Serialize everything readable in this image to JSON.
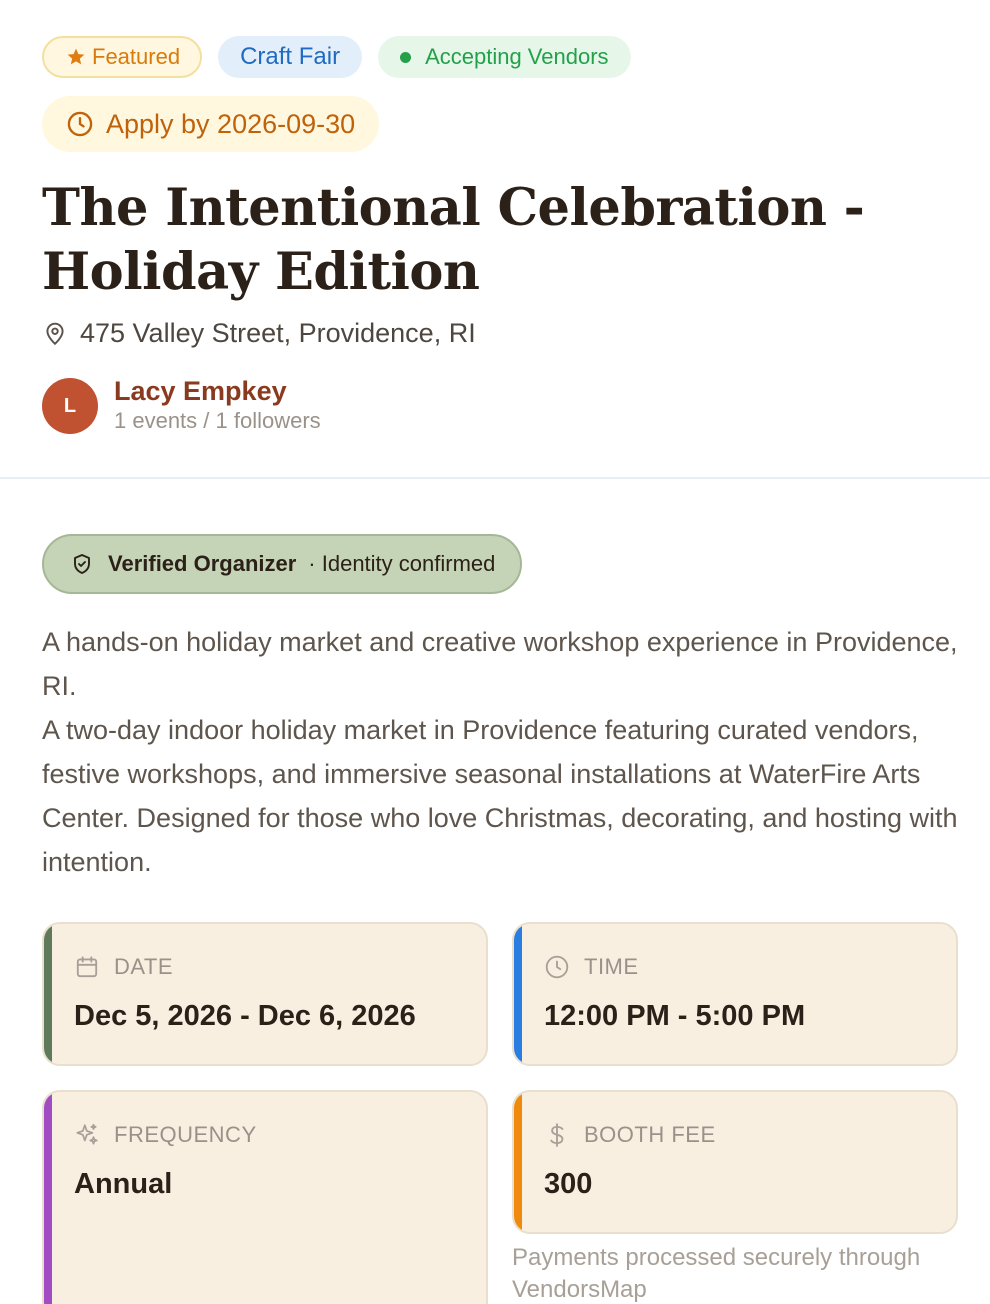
{
  "badges": {
    "featured": "Featured",
    "category": "Craft Fair",
    "status": "Accepting Vendors"
  },
  "deadline": "Apply by 2026-09-30",
  "event": {
    "title": "The Intentional Celebration - Holiday Edition",
    "location": "475 Valley Street, Providence, RI"
  },
  "organizer": {
    "initial": "L",
    "name": "Lacy Empkey",
    "stats": "1 events / 1 followers"
  },
  "verified": {
    "title": "Verified Organizer",
    "subtitle": "· Identity confirmed"
  },
  "description": {
    "line1": "A hands-on holiday market and creative workshop experience in Providence, RI.",
    "line2": "A two-day indoor holiday market in Providence featuring curated vendors, festive workshops, and immersive seasonal installations at WaterFire Arts Center. Designed for those who love Christmas, decorating, and hosting with intention."
  },
  "details": {
    "date": {
      "label": "DATE",
      "value": "Dec 5, 2026 - Dec 6, 2026",
      "icon": "calendar-icon",
      "color": "#5f7a5a"
    },
    "time": {
      "label": "TIME",
      "value": "12:00 PM - 5:00 PM",
      "icon": "clock-icon",
      "color": "#2a7de1"
    },
    "frequency": {
      "label": "FREQUENCY",
      "value": "Annual",
      "icon": "sparkle-icon",
      "color": "#a24cc4"
    },
    "booth_fee": {
      "label": "BOOTH FEE",
      "value": "300",
      "icon": "dollar-icon",
      "color": "#f08a0c",
      "note": "Payments processed securely through VendorsMap"
    }
  }
}
